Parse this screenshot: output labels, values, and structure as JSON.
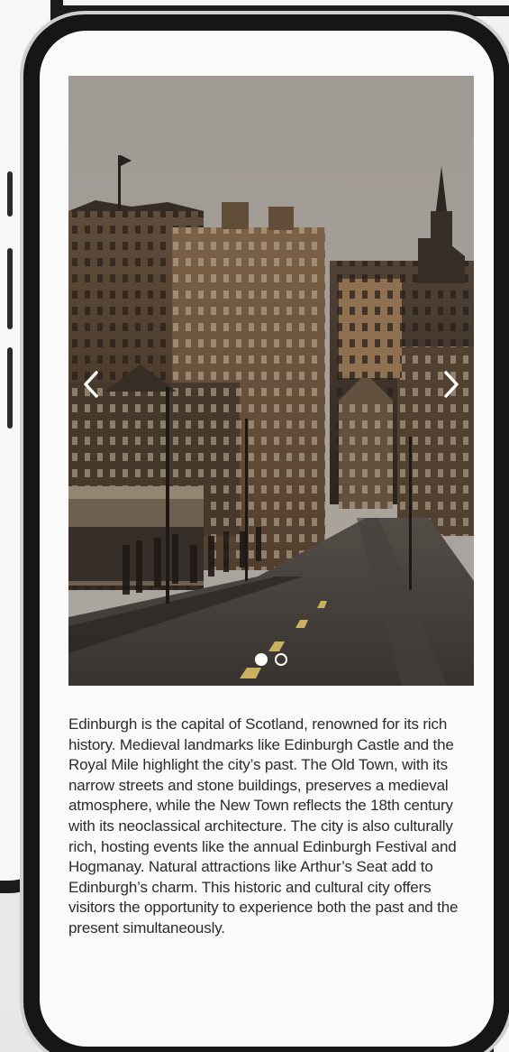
{
  "carousel": {
    "image": "Edinburgh Old Town street view",
    "prev_icon": "chevron-left-icon",
    "next_icon": "chevron-right-icon",
    "slide_count": 2,
    "active_slide": 1
  },
  "description": "Edinburgh is the capital of Scotland, renowned for its rich history. Medieval landmarks like Edinburgh Castle and the Royal Mile highlight the city’s past. The Old Town, with its narrow streets and stone buildings, preserves a medieval atmosphere, while the New Town reflects the 18th century with its neoclassical architecture. The city is also culturally rich, hosting events like the annual Edinburgh Festival and Hogmanay. Natural attractions like Arthur’s Seat add to Edinburgh’s charm. This historic and cultural city offers visitors the opportunity to experience both the past and the present simultaneously.",
  "colors": {
    "bezel": "#161616",
    "screen": "#fafafa",
    "text": "#2c2c2c",
    "stone": "#6d5f4c",
    "sky": "#b9b4ae"
  }
}
